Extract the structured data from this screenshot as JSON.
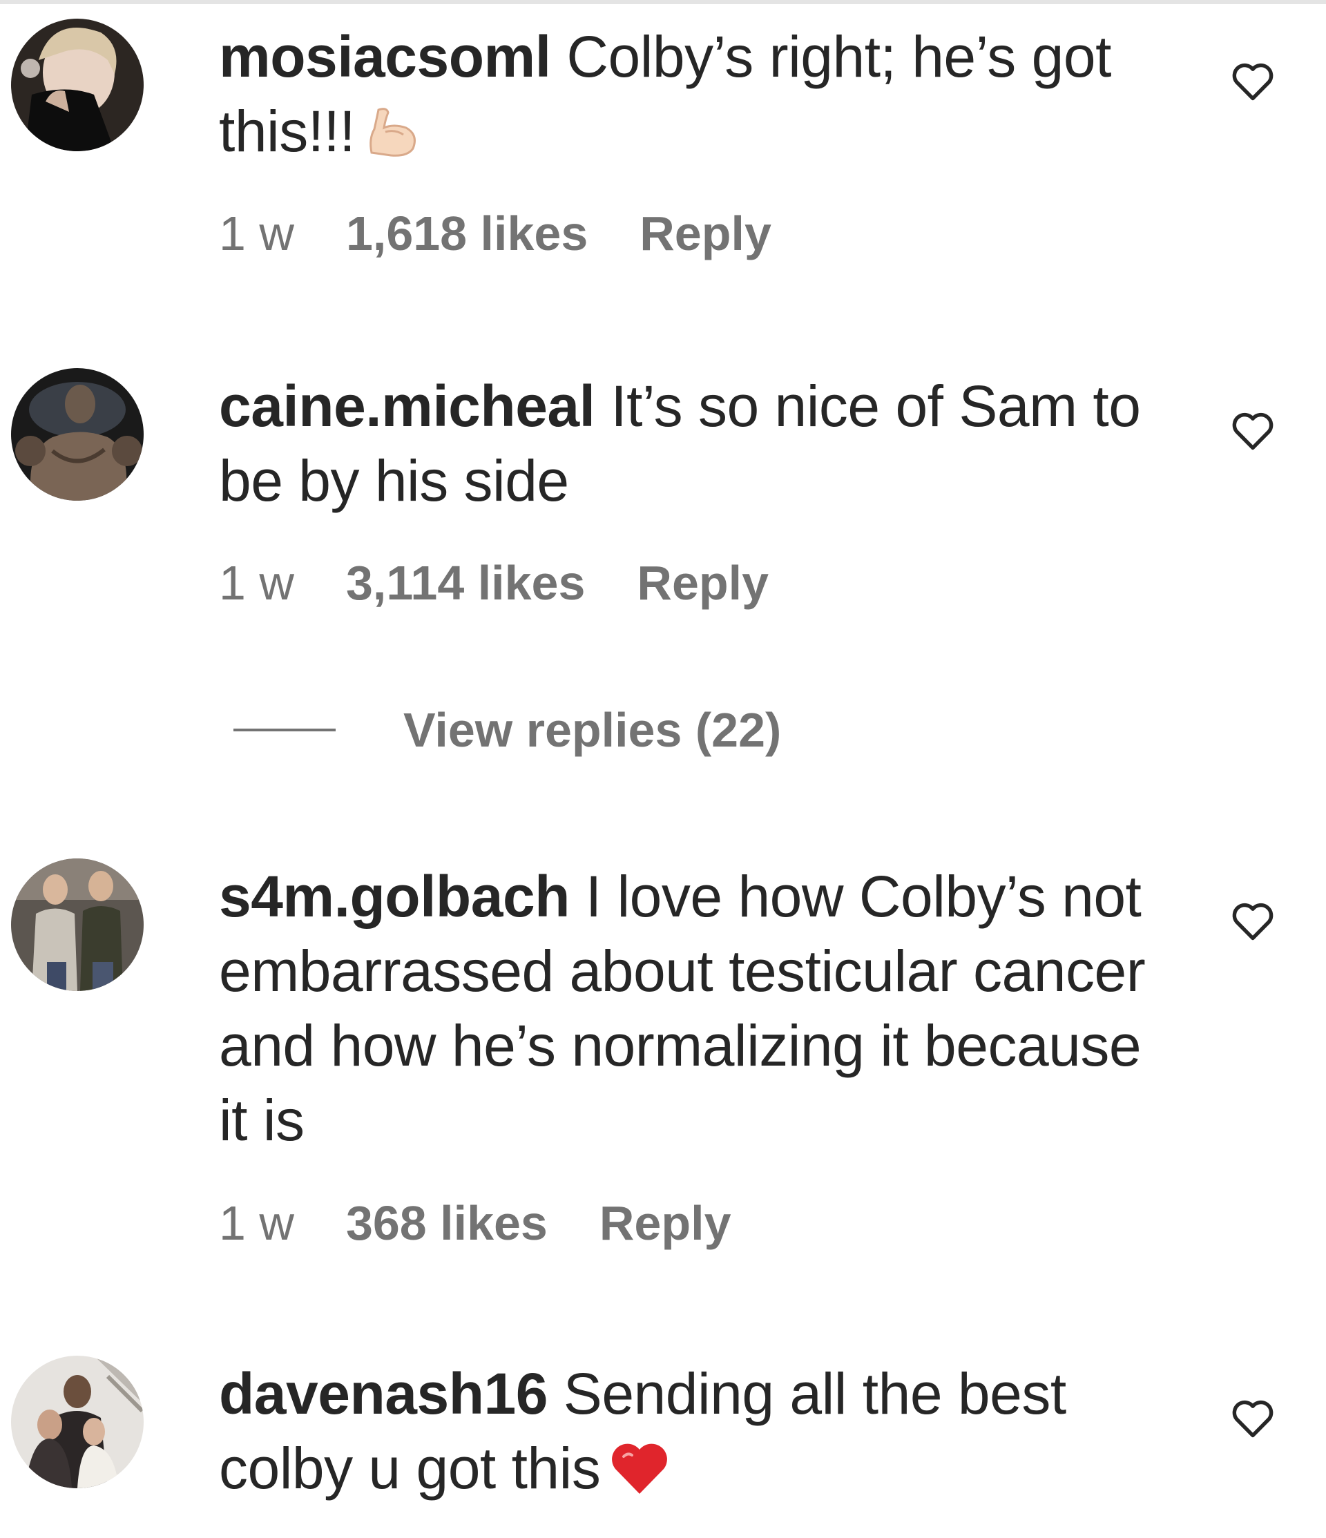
{
  "comments": [
    {
      "username": "mosiacsoml",
      "text": "Colby’s right; he’s got this!!!",
      "emoji": "flexed-biceps",
      "time": "1 w",
      "likes": "1,618 likes",
      "reply_label": "Reply"
    },
    {
      "username": "caine.micheal",
      "text": "It’s so nice of Sam to be by his side",
      "time": "1 w",
      "likes": "3,114 likes",
      "reply_label": "Reply",
      "view_replies": "View replies (22)"
    },
    {
      "username": "s4m.golbach",
      "text": "I love how Colby’s not embarrassed about testicular cancer and how he’s normalizing it because it is",
      "time": "1 w",
      "likes": "368 likes",
      "reply_label": "Reply"
    },
    {
      "username": "davenash16",
      "text": "Sending all the best colby u got this",
      "emoji": "red-heart"
    }
  ],
  "icons": {
    "like": "heart-outline-icon"
  },
  "colors": {
    "text": "#262626",
    "secondary": "#737373",
    "emoji_heart": "#e0252c",
    "emoji_arm": "#f6d7bd"
  }
}
